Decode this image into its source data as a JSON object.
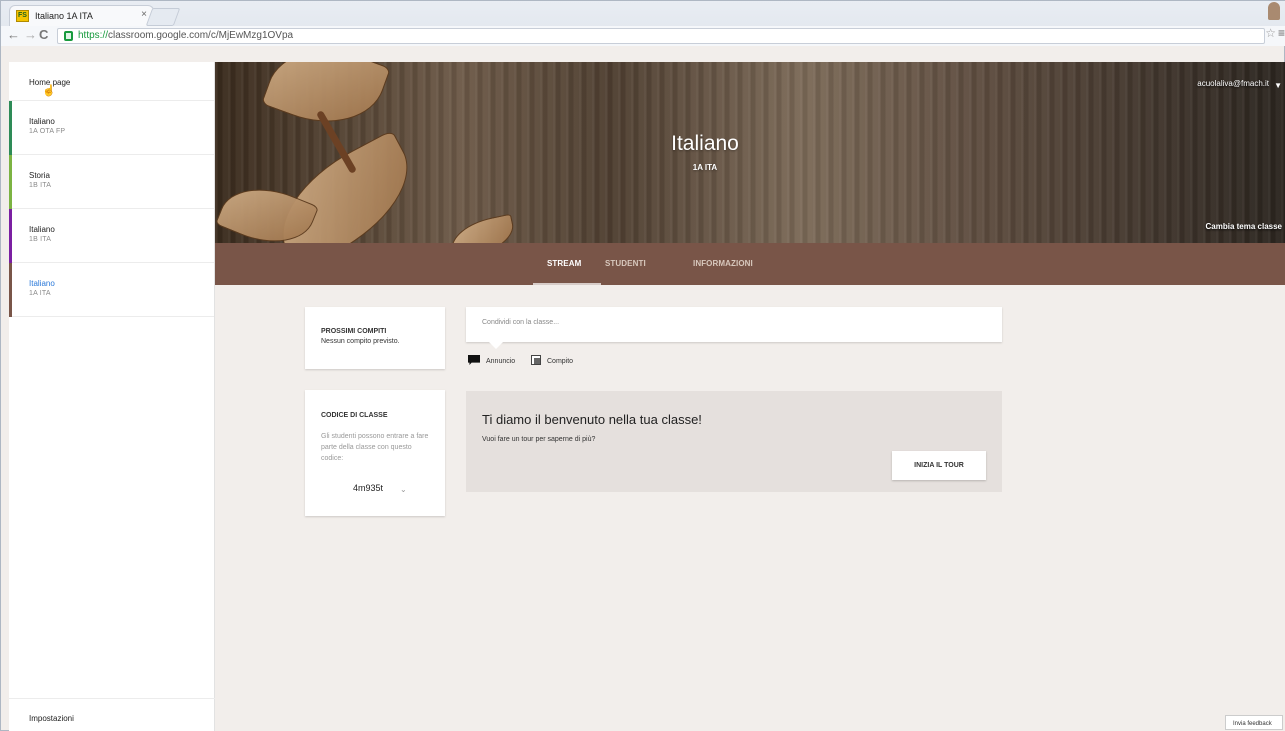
{
  "browser": {
    "tab_title": "Italiano 1A ITA",
    "favicon_text": "FS",
    "close": "×",
    "url_https": "https://",
    "url_rest": "classroom.google.com/c/MjEwMzg1OVpa"
  },
  "sidebar": {
    "home": "Home page",
    "items": [
      {
        "name": "Italiano",
        "section": "1A OTA FP",
        "color": "#2e8b57"
      },
      {
        "name": "Storia",
        "section": "1B ITA",
        "color": "#7cb342"
      },
      {
        "name": "Italiano",
        "section": "1B ITA",
        "color": "#7b1fa2"
      },
      {
        "name": "Italiano",
        "section": "1A ITA",
        "color": "#795548"
      }
    ],
    "settings": "Impostazioni"
  },
  "hero": {
    "title": "Italiano",
    "section": "1A ITA",
    "account": "acuolaliva@fmach.it",
    "theme_link": "Cambia tema classe"
  },
  "tabs": {
    "stream": "STREAM",
    "students": "STUDENTI",
    "info": "INFORMAZIONI"
  },
  "cards": {
    "next_title": "PROSSIMI COMPITI",
    "next_text": "Nessun compito previsto.",
    "code_title": "CODICE DI CLASSE",
    "code_description": "Gli studenti possono entrare a fare parte della classe con questo codice:",
    "code": "4m935t"
  },
  "stream": {
    "share_placeholder": "Condividi con la classe...",
    "announcement": "Annuncio",
    "assignment": "Compito",
    "welcome_title": "Ti diamo il benvenuto nella tua classe!",
    "welcome_text": "Vuoi fare un tour per saperne di più?",
    "tour_button": "INIZIA IL TOUR"
  },
  "feedback": "Invia feedback",
  "icons": {
    "back": "back-arrow-icon",
    "forward": "forward-arrow-icon",
    "reload": "reload-icon",
    "lock": "lock-icon",
    "star": "star-icon",
    "menu": "menu-icon",
    "announcement": "announcement-icon",
    "assignment": "assignment-icon"
  }
}
